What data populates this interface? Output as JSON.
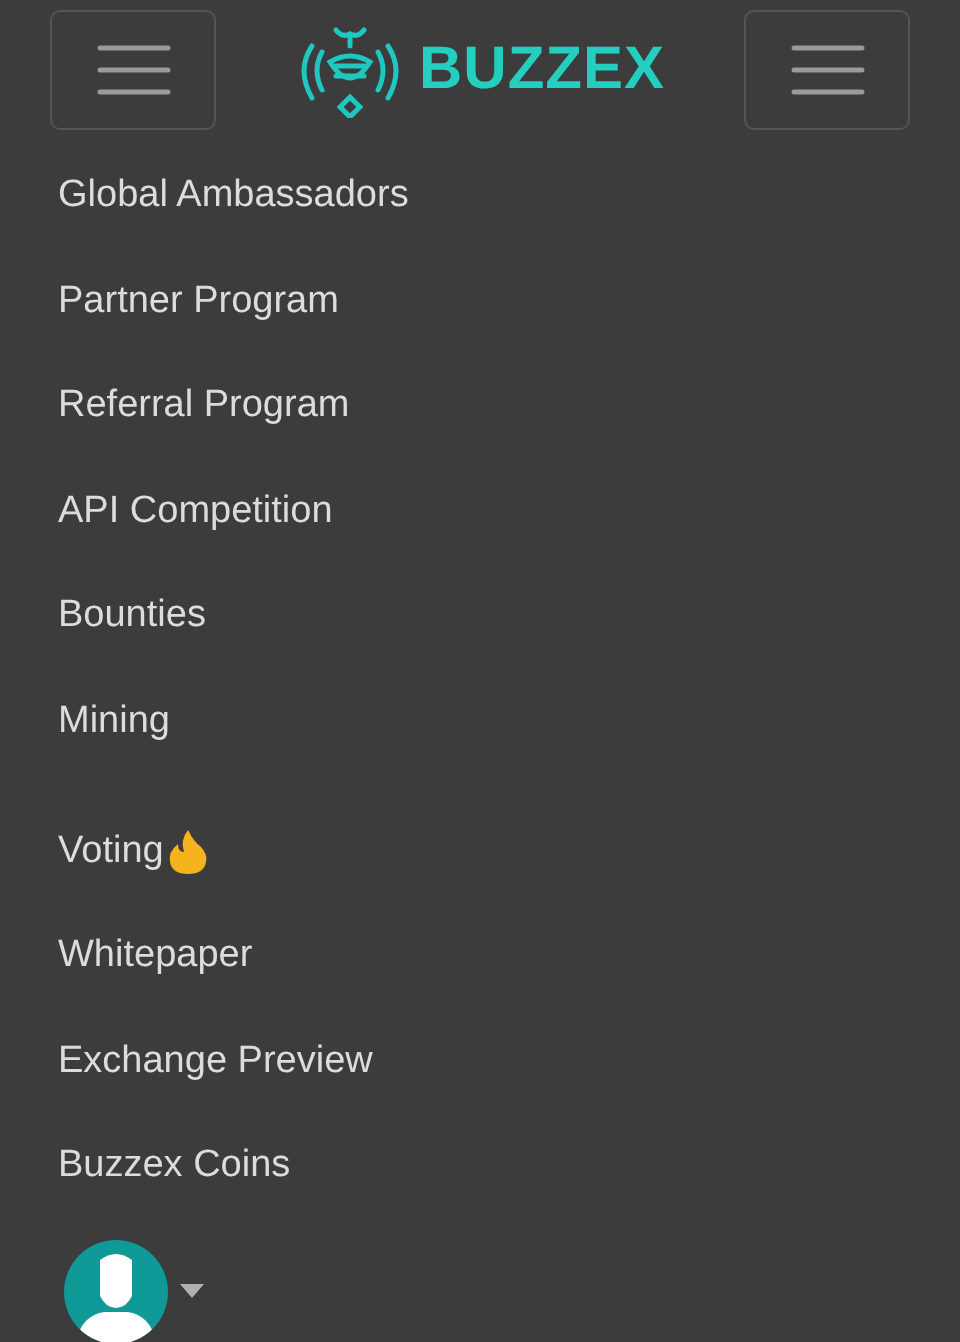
{
  "header": {
    "logo_text": "BUZZEX"
  },
  "menu": [
    {
      "label": "Global Ambassadors",
      "hot": false
    },
    {
      "label": "Partner Program",
      "hot": false
    },
    {
      "label": "Referral Program",
      "hot": false
    },
    {
      "label": "API Competition",
      "hot": false
    },
    {
      "label": "Bounties",
      "hot": false
    },
    {
      "label": "Mining",
      "hot": false
    },
    {
      "label": "Voting",
      "hot": true
    },
    {
      "label": "Whitepaper",
      "hot": false
    },
    {
      "label": "Exchange Preview",
      "hot": false
    },
    {
      "label": "Buzzex Coins",
      "hot": false
    }
  ]
}
